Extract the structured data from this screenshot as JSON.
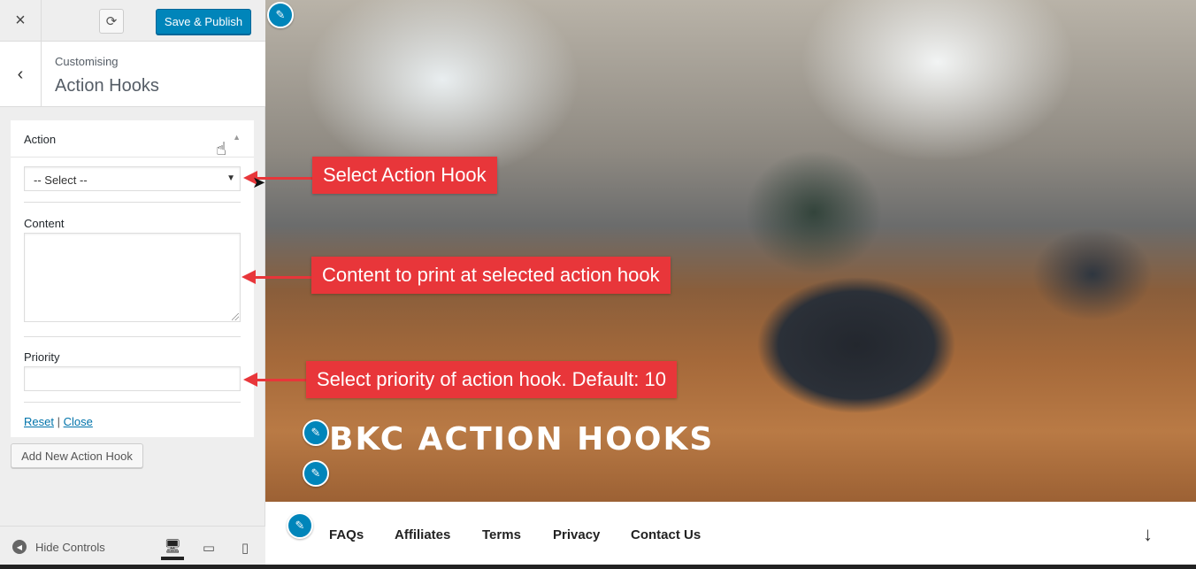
{
  "topbar": {
    "close_icon": "×",
    "refresh_icon": "⟳",
    "publish_label": "Save & Publish"
  },
  "section": {
    "back_icon": "‹",
    "subtitle": "Customising",
    "title": "Action Hooks"
  },
  "panel": {
    "title": "Action",
    "select_value": "-- Select --",
    "content_label": "Content",
    "priority_label": "Priority",
    "reset_label": "Reset",
    "separator": "|",
    "close_label": "Close"
  },
  "add_button_label": "Add New Action Hook",
  "footer": {
    "hide_controls_label": "Hide Controls",
    "devices": [
      "desktop",
      "tablet",
      "mobile"
    ],
    "active_device": "desktop"
  },
  "preview": {
    "site_title": "BKC ACTION HOOKS",
    "nav_items": [
      "FAQs",
      "Affiliates",
      "Terms",
      "Privacy",
      "Contact Us"
    ],
    "scroll_arrow": "↓"
  },
  "callouts": {
    "action": "Select Action Hook",
    "content": "Content to print at selected action hook",
    "priority": "Select priority of action hook. Default: 10"
  },
  "colors": {
    "accent": "#0085ba",
    "callout": "#e8363a",
    "sidebar_bg": "#eeeeee"
  }
}
